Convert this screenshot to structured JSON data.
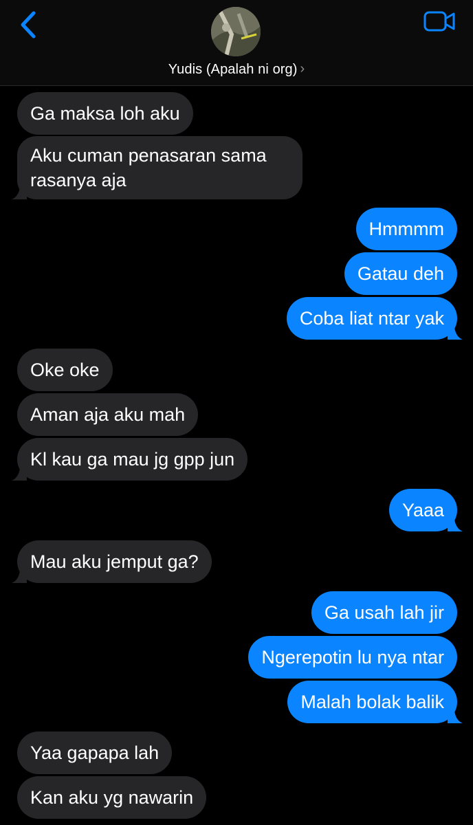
{
  "header": {
    "contact_name": "Yudis (Apalah ni org)",
    "chevron": "›",
    "back_icon": "chevron-left-icon",
    "video_icon": "video-camera-icon"
  },
  "colors": {
    "accent": "#0b84ff",
    "incoming_bubble": "#262628",
    "background": "#000000"
  },
  "messages": [
    {
      "text": "Ga maksa loh aku",
      "direction": "incoming"
    },
    {
      "text": "Aku cuman penasaran sama rasanya aja",
      "direction": "incoming"
    },
    {
      "text": "Hmmmm",
      "direction": "outgoing"
    },
    {
      "text": "Gatau deh",
      "direction": "outgoing"
    },
    {
      "text": "Coba liat ntar yak",
      "direction": "outgoing"
    },
    {
      "text": "Oke oke",
      "direction": "incoming"
    },
    {
      "text": "Aman aja aku mah",
      "direction": "incoming"
    },
    {
      "text": "Kl kau ga mau jg gpp jun",
      "direction": "incoming"
    },
    {
      "text": "Yaaa",
      "direction": "outgoing"
    },
    {
      "text": "Mau aku jemput ga?",
      "direction": "incoming"
    },
    {
      "text": "Ga usah lah jir",
      "direction": "outgoing"
    },
    {
      "text": "Ngerepotin lu nya ntar",
      "direction": "outgoing"
    },
    {
      "text": "Malah bolak balik",
      "direction": "outgoing"
    },
    {
      "text": "Yaa gapapa lah",
      "direction": "incoming"
    },
    {
      "text": "Kan aku yg nawarin",
      "direction": "incoming"
    }
  ]
}
